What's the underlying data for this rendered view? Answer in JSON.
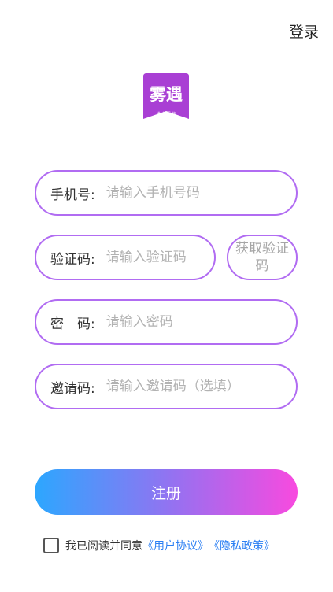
{
  "header": {
    "login_label": "登录"
  },
  "logo": {
    "text_main": "雾遇",
    "text_sub": "线 上 写 作"
  },
  "form": {
    "phone": {
      "label": "手机号:",
      "placeholder": "请输入手机号码"
    },
    "code": {
      "label": "验证码:",
      "placeholder": "请输入验证码",
      "get_code_label": "获取验证码"
    },
    "password": {
      "label": "密　码:",
      "placeholder": "请输入密码"
    },
    "invite": {
      "label": "邀请码:",
      "placeholder": "请输入邀请码（选填）"
    }
  },
  "register_label": "注册",
  "agreement": {
    "prefix": "我已阅读并同意",
    "user_agreement": "《用户协议》",
    "privacy_policy": "《隐私政策》"
  },
  "colors": {
    "accent": "#b16cf2",
    "gradient_start": "#2ca7ff",
    "gradient_end": "#f84adf",
    "link": "#2b7ff3"
  }
}
